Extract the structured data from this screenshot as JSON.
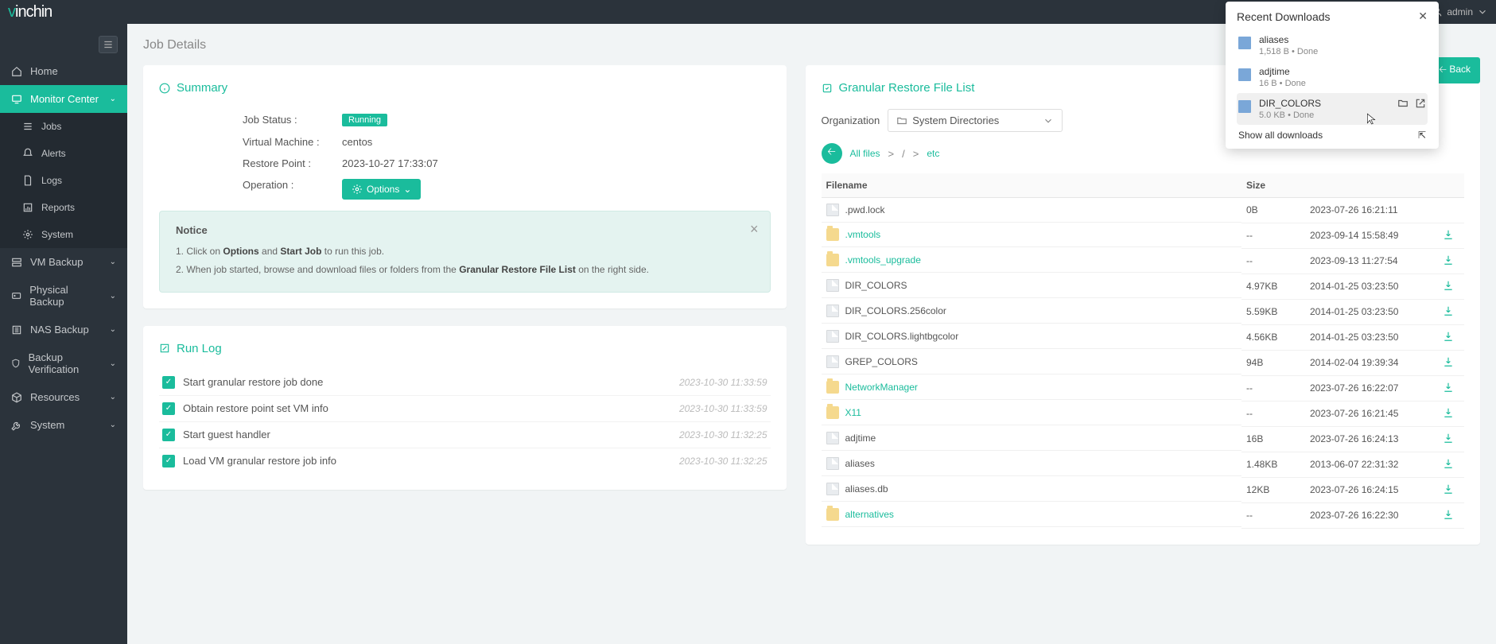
{
  "topbar": {
    "logo_pre": "v",
    "logo_mid": "inch",
    "logo_post": "in",
    "user": "admin"
  },
  "sidebar": {
    "items": [
      {
        "icon": "home",
        "label": "Home"
      },
      {
        "icon": "monitor",
        "label": "Monitor Center",
        "active": true,
        "expandable": true
      },
      {
        "sub": true,
        "icon": "list",
        "label": "Jobs"
      },
      {
        "sub": true,
        "icon": "bell",
        "label": "Alerts"
      },
      {
        "sub": true,
        "icon": "file",
        "label": "Logs"
      },
      {
        "sub": true,
        "icon": "report",
        "label": "Reports"
      },
      {
        "sub": true,
        "icon": "gear",
        "label": "System"
      },
      {
        "icon": "server",
        "label": "VM Backup",
        "expandable": true
      },
      {
        "icon": "hdd",
        "label": "Physical Backup",
        "expandable": true
      },
      {
        "icon": "nas",
        "label": "NAS Backup",
        "expandable": true
      },
      {
        "icon": "shield",
        "label": "Backup Verification",
        "expandable": true
      },
      {
        "icon": "cube",
        "label": "Resources",
        "expandable": true
      },
      {
        "icon": "wrench",
        "label": "System",
        "expandable": true
      }
    ]
  },
  "page": {
    "title": "Job Details",
    "back_label": "Back"
  },
  "summary": {
    "header": "Summary",
    "rows": [
      {
        "label": "Job Status :",
        "value": "Running",
        "badge": true
      },
      {
        "label": "Virtual Machine :",
        "value": "centos"
      },
      {
        "label": "Restore Point :",
        "value": "2023-10-27 17:33:07"
      },
      {
        "label": "Operation :",
        "value": "Options",
        "button": true
      }
    ]
  },
  "notice": {
    "title": "Notice",
    "line1_pre": "1. Click on ",
    "line1_b1": "Options",
    "line1_mid": " and ",
    "line1_b2": "Start Job",
    "line1_post": " to run this job.",
    "line2_pre": "2. When job started, browse and download files or folders from the ",
    "line2_b1": "Granular Restore File List",
    "line2_post": " on the right side."
  },
  "runlog": {
    "header": "Run Log",
    "items": [
      {
        "text": "Start granular restore job done",
        "time": "2023-10-30 11:33:59"
      },
      {
        "text": "Obtain restore point set VM info",
        "time": "2023-10-30 11:33:59"
      },
      {
        "text": "Start guest handler",
        "time": "2023-10-30 11:32:25"
      },
      {
        "text": "Load VM granular restore job info",
        "time": "2023-10-30 11:32:25"
      }
    ]
  },
  "filelist": {
    "header": "Granular Restore File List",
    "org_label": "Organization",
    "org_value": "System Directories",
    "breadcrumb": {
      "root": "All files",
      "sep": ">",
      "slash": "/",
      "current": "etc"
    },
    "columns": {
      "name": "Filename",
      "size": "Size",
      "date": "",
      "action": ""
    },
    "rows": [
      {
        "type": "file",
        "name": ".pwd.lock",
        "size": "0B",
        "date": "2023-07-26 16:21:11",
        "dl": false
      },
      {
        "type": "folder",
        "name": ".vmtools",
        "size": "--",
        "date": "2023-09-14 15:58:49",
        "dl": true
      },
      {
        "type": "folder",
        "name": ".vmtools_upgrade",
        "size": "--",
        "date": "2023-09-13 11:27:54",
        "dl": true
      },
      {
        "type": "file",
        "name": "DIR_COLORS",
        "size": "4.97KB",
        "date": "2014-01-25 03:23:50",
        "dl": true
      },
      {
        "type": "file",
        "name": "DIR_COLORS.256color",
        "size": "5.59KB",
        "date": "2014-01-25 03:23:50",
        "dl": true
      },
      {
        "type": "file",
        "name": "DIR_COLORS.lightbgcolor",
        "size": "4.56KB",
        "date": "2014-01-25 03:23:50",
        "dl": true
      },
      {
        "type": "file",
        "name": "GREP_COLORS",
        "size": "94B",
        "date": "2014-02-04 19:39:34",
        "dl": true
      },
      {
        "type": "folder",
        "name": "NetworkManager",
        "size": "--",
        "date": "2023-07-26 16:22:07",
        "dl": true
      },
      {
        "type": "folder",
        "name": "X11",
        "size": "--",
        "date": "2023-07-26 16:21:45",
        "dl": true
      },
      {
        "type": "file",
        "name": "adjtime",
        "size": "16B",
        "date": "2023-07-26 16:24:13",
        "dl": true
      },
      {
        "type": "file",
        "name": "aliases",
        "size": "1.48KB",
        "date": "2013-06-07 22:31:32",
        "dl": true
      },
      {
        "type": "file",
        "name": "aliases.db",
        "size": "12KB",
        "date": "2023-07-26 16:24:15",
        "dl": true
      },
      {
        "type": "folder",
        "name": "alternatives",
        "size": "--",
        "date": "2023-07-26 16:22:30",
        "dl": true
      }
    ]
  },
  "downloads": {
    "title": "Recent Downloads",
    "show_all": "Show all downloads",
    "items": [
      {
        "name": "aliases",
        "meta": "1,518 B • Done"
      },
      {
        "name": "adjtime",
        "meta": "16 B • Done"
      },
      {
        "name": "DIR_COLORS",
        "meta": "5.0 KB • Done",
        "hovered": true
      }
    ]
  }
}
